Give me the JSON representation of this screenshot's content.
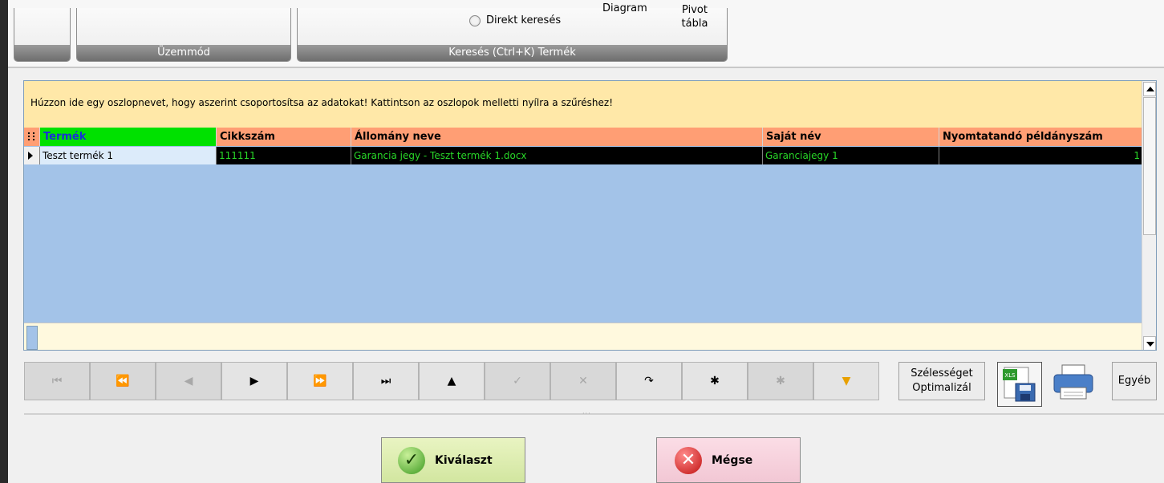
{
  "ribbon": {
    "group_uzemmod": "Üzemmód",
    "group_kereses": "Keresés (Ctrl+K) Termék",
    "radio_direkt": "Direkt keresés",
    "btn_diagram": "Diagram",
    "btn_pivot": "Pivot\ntábla"
  },
  "grid": {
    "group_hint": "Húzzon ide egy oszlopnevet, hogy aszerint csoportosítsa az adatokat! Kattintson az oszlopok melletti nyílra a szűréshez!",
    "columns": [
      "Termék",
      "Cikkszám",
      "Állomány neve",
      "Saját név",
      "Nyomtatandó példányszám"
    ],
    "rows": [
      [
        "Teszt termék 1",
        "111111",
        "Garancia jegy - Teszt termék 1.docx",
        "Garanciajegy 1",
        "1"
      ]
    ]
  },
  "navigator": {
    "buttons": [
      "⏮",
      "⏪",
      "◀",
      "▶",
      "⏩",
      "⏭",
      "▲",
      "✓",
      "✕",
      "↷",
      "✱",
      "✱",
      "▼"
    ],
    "disabled": [
      true,
      true,
      true,
      false,
      false,
      false,
      false,
      true,
      true,
      false,
      false,
      true,
      false
    ]
  },
  "toolbar": {
    "optimize_label": "Szélességet\nOptimalizál",
    "xls_label": "XLS",
    "egyeb_label": "Egyéb"
  },
  "actions": {
    "ok_label": "Kiválaszt",
    "cancel_label": "Mégse"
  }
}
